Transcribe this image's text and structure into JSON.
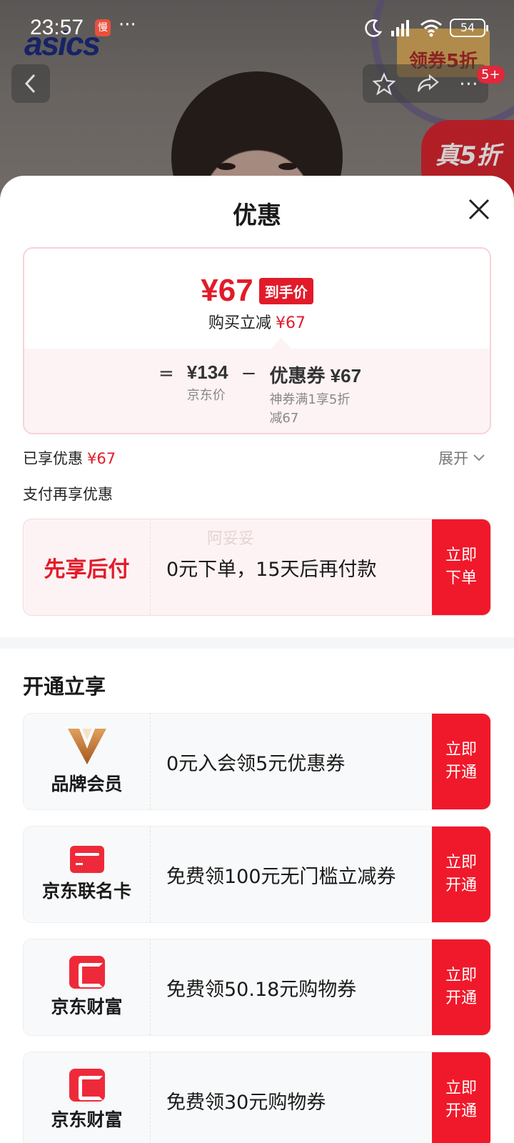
{
  "status_bar": {
    "time": "23:57",
    "app_badge": "慢",
    "more": "···",
    "battery": "54"
  },
  "background": {
    "brand_logo": "asics",
    "coupon_tag": "领券5折",
    "promo_badge": "真5折",
    "cart_count": "5+"
  },
  "icons": {
    "back": "chevron-left-icon",
    "favorite": "star-icon",
    "share": "share-icon",
    "more": "more-icon",
    "close": "close-icon",
    "expand": "chevron-down-icon",
    "brand_member": "v-logo-icon",
    "co_brand_card": "credit-card-icon",
    "jd_finance": "jd-finance-icon"
  },
  "colors": {
    "accent": "#e21b2a",
    "cta": "#f0192b",
    "pay_bg": "#fdf3f4"
  },
  "sheet": {
    "title": "优惠",
    "price": {
      "final": "¥67",
      "final_tag": "到手价",
      "discount_label": "购买立减",
      "discount_value": "¥67"
    },
    "calculation": {
      "eq": "=",
      "base_value": "¥134",
      "base_label": "京东价",
      "minus": "−",
      "coupon_value": "优惠券 ¥67",
      "coupon_desc": "神券满1享5折减67"
    },
    "enjoyed_label": "已享优惠",
    "enjoyed_value": "¥67",
    "expand_label": "展开",
    "pay_more_label": "支付再享优惠",
    "pay_later": {
      "label": "先享后付",
      "desc": "0元下单，15天后再付款",
      "cta": "立即下单"
    },
    "watermark": "阿妥妥",
    "open_section_title": "开通立享",
    "offers": [
      {
        "label": "品牌会员",
        "desc": "0元入会领5元优惠券",
        "cta": "立即开通"
      },
      {
        "label": "京东联名卡",
        "desc": "免费领100元无门槛立减券",
        "cta": "立即开通"
      },
      {
        "label": "京东财富",
        "desc": "免费领50.18元购物券",
        "cta": "立即开通"
      },
      {
        "label": "京东财富",
        "desc": "免费领30元购物券",
        "cta": "立即开通"
      }
    ]
  }
}
